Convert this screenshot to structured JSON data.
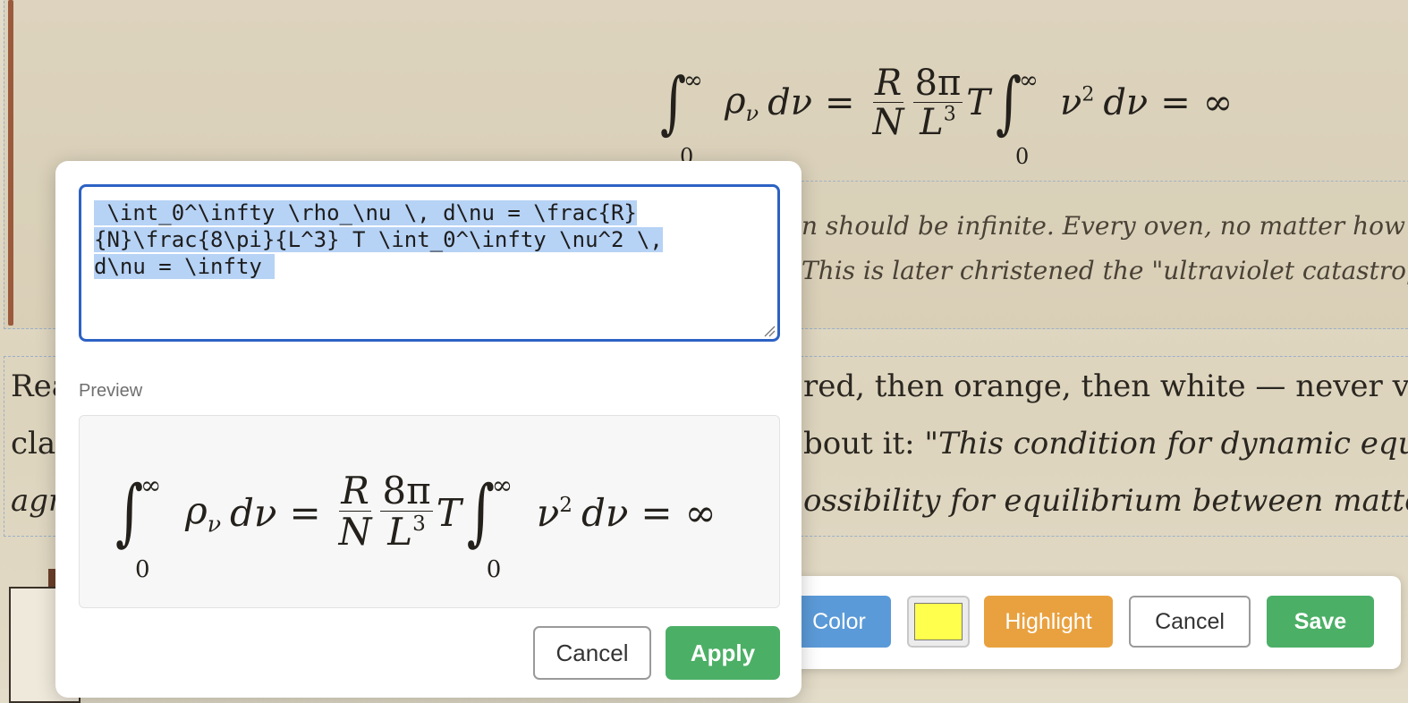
{
  "equation": {
    "int_lower": "0",
    "int_upper": "∞",
    "rho": "ρ",
    "rho_sub": "ν",
    "dnu": "dν",
    "equals": "=",
    "frac1_num": "R",
    "frac1_den": "N",
    "frac2_num": "8π",
    "frac2_den": "L",
    "frac2_den_exp": "3",
    "T": "T",
    "nu": "ν",
    "nu_exp": "2",
    "infinity": "∞"
  },
  "article": {
    "quote_line_1": "n should be infinite. Every oven, no matter how co",
    "quote_line_2": "This is later christened the \"ultraviolet catastrophe",
    "para_left_1": "Rea",
    "para_left_2": "clas",
    "para_left_3": "agr",
    "para_right_1": "red, then orange, then white — never vio",
    "para_right_2_plain": "bout it: ",
    "para_right_2_italic": "\"This condition for dynamic equ",
    "para_right_3": "ossibility for equilibrium between matte"
  },
  "editor": {
    "latex_source": " \\int_0^\\infty \\rho_\\nu \\, d\\nu = \\frac{R}\n{N}\\frac{8\\pi}{L^3} T \\int_0^\\infty \\nu^2 \\,\nd\\nu = \\infty ",
    "preview_label": "Preview",
    "cancel_label": "Cancel",
    "apply_label": "Apply"
  },
  "toolbar": {
    "color_label": "Color",
    "swatch_color": "#ffff4d",
    "highlight_label": "Highlight",
    "cancel_label": "Cancel",
    "save_label": "Save"
  }
}
